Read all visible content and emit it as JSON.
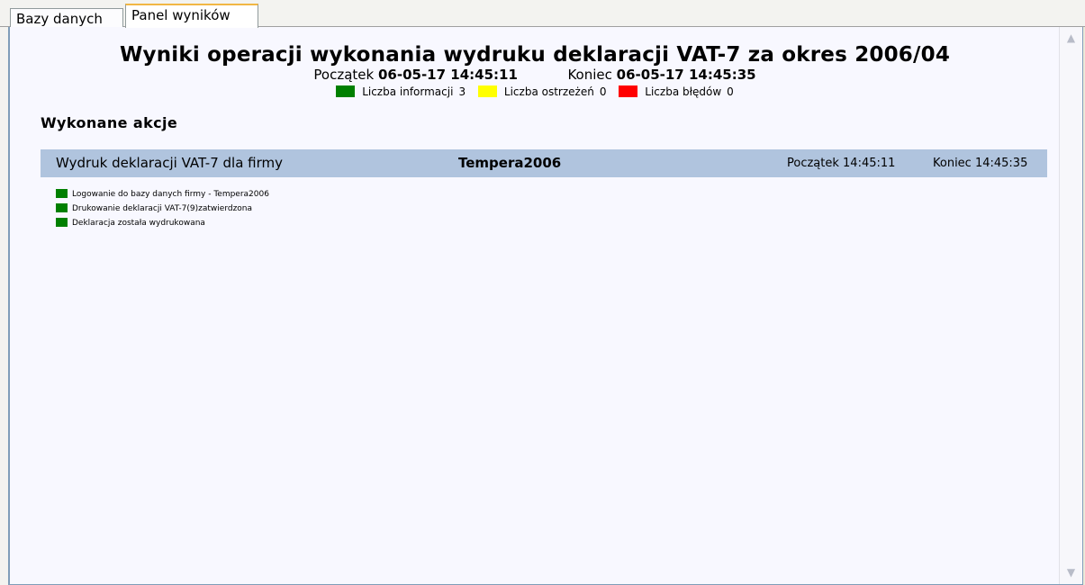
{
  "tabs": [
    {
      "label": "Bazy danych",
      "active": false
    },
    {
      "label": "Panel wyników",
      "active": true
    }
  ],
  "report": {
    "title": "Wyniki operacji wykonania wydruku deklaracji VAT-7 za okres 2006/04",
    "start_label": "Początek",
    "start_value": "06-05-17 14:45:11",
    "end_label": "Koniec",
    "end_value": "06-05-17 14:45:35"
  },
  "legend": [
    {
      "label": "Liczba informacji",
      "count": "3",
      "color": "#008000"
    },
    {
      "label": "Liczba ostrzeżeń",
      "count": "0",
      "color": "#ffff00"
    },
    {
      "label": "Liczba błędów",
      "count": "0",
      "color": "#ff0000"
    }
  ],
  "actions": {
    "section_title": "Wykonane akcje",
    "items": [
      {
        "name": "Wydruk deklaracji VAT-7 dla firmy",
        "firm": "Tempera2006",
        "start": "Początek 14:45:11",
        "end": "Koniec 14:45:35",
        "messages": [
          {
            "text": "Logowanie do bazy danych firmy - Tempera2006",
            "color": "#008000"
          },
          {
            "text": "Drukowanie deklaracji VAT-7(9)zatwierdzona",
            "color": "#008000"
          },
          {
            "text": "Deklaracja została wydrukowana",
            "color": "#008000"
          }
        ]
      }
    ]
  },
  "colors": {
    "action_bar": "#b0c4de",
    "panel_bg": "#f8f8ff"
  }
}
